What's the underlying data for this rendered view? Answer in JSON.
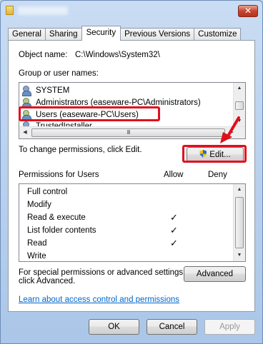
{
  "window": {
    "close_glyph": "✕"
  },
  "tabs": [
    {
      "label": "General"
    },
    {
      "label": "Sharing"
    },
    {
      "label": "Security",
      "active": true
    },
    {
      "label": "Previous Versions"
    },
    {
      "label": "Customize"
    }
  ],
  "object": {
    "label": "Object name:",
    "value": "C:\\Windows\\System32\\"
  },
  "groups": {
    "label": "Group or user names:",
    "items": [
      {
        "name": "SYSTEM",
        "icon": "user-icon"
      },
      {
        "name": "Administrators (easeware-PC\\Administrators)",
        "icon": "group-icon"
      },
      {
        "name": "Users (easeware-PC\\Users)",
        "icon": "group-icon",
        "selected": true
      },
      {
        "name": "TrustedInstaller",
        "icon": "user-icon"
      }
    ],
    "hscroll_grip": "III"
  },
  "change_text": "To change permissions, click Edit.",
  "edit_button": "Edit...",
  "permissions": {
    "title": "Permissions for Users",
    "allow_header": "Allow",
    "deny_header": "Deny",
    "rows": [
      {
        "name": "Full control",
        "allow": false
      },
      {
        "name": "Modify",
        "allow": false
      },
      {
        "name": "Read & execute",
        "allow": true
      },
      {
        "name": "List folder contents",
        "allow": true
      },
      {
        "name": "Read",
        "allow": true
      },
      {
        "name": "Write",
        "allow": false
      }
    ],
    "check_glyph": "✓"
  },
  "special": {
    "line1": "For special permissions or advanced settings,",
    "line2": "click Advanced.",
    "button": "Advanced"
  },
  "learn_link": "Learn about access control and permissions",
  "footer": {
    "ok": "OK",
    "cancel": "Cancel",
    "apply": "Apply"
  },
  "colors": {
    "highlight": "#e0101b",
    "link": "#0066cc"
  }
}
